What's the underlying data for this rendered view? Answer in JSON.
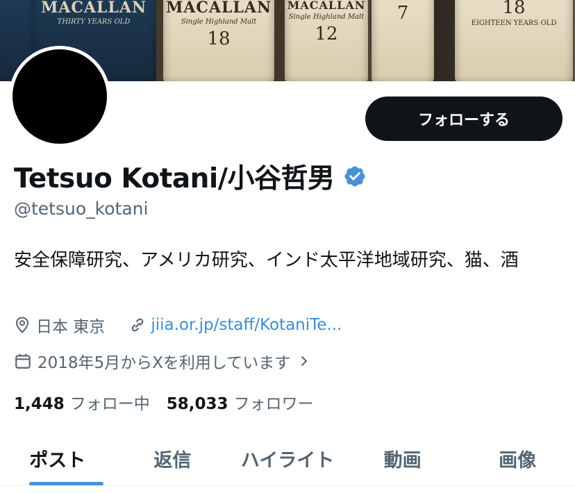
{
  "banner": {
    "bottles": [
      {
        "brand": "MACALLAN",
        "sub": "THIRTY YEARS OLD",
        "age": ""
      },
      {
        "brand": "MACALLAN",
        "sub": "Single Highland Malt",
        "age": "18"
      },
      {
        "brand": "MACALLAN",
        "sub": "Single Highland Malt",
        "age": "12"
      },
      {
        "brand": "",
        "sub": "",
        "age": "7"
      },
      {
        "brand": "EIGHTEEN YEARS OLD",
        "sub": "",
        "age": "18"
      }
    ]
  },
  "profile": {
    "follow_label": "フォローする",
    "name": "Tetsuo Kotani/小谷哲男",
    "handle": "@tetsuo_kotani",
    "bio": "安全保障研究、アメリカ研究、インド太平洋地域研究、猫、酒",
    "location": "日本 東京",
    "link": "jiia.or.jp/staff/KotaniTe...",
    "joined": "2018年5月からXを利用しています",
    "following_count": "1,448",
    "following_label": "フォロー中",
    "followers_count": "58,033",
    "followers_label": "フォロワー"
  },
  "tabs": [
    {
      "label": "ポスト",
      "active": true
    },
    {
      "label": "返信"
    },
    {
      "label": "ハイライト"
    },
    {
      "label": "動画"
    },
    {
      "label": "画像"
    }
  ],
  "colors": {
    "accent": "#4a90d9",
    "verified": "#4a90d9",
    "link": "#3b8ed4",
    "button": "#0f1419"
  },
  "icons": [
    "location-icon",
    "link-icon",
    "calendar-icon",
    "chevron-right-icon",
    "verified-badge-icon"
  ]
}
